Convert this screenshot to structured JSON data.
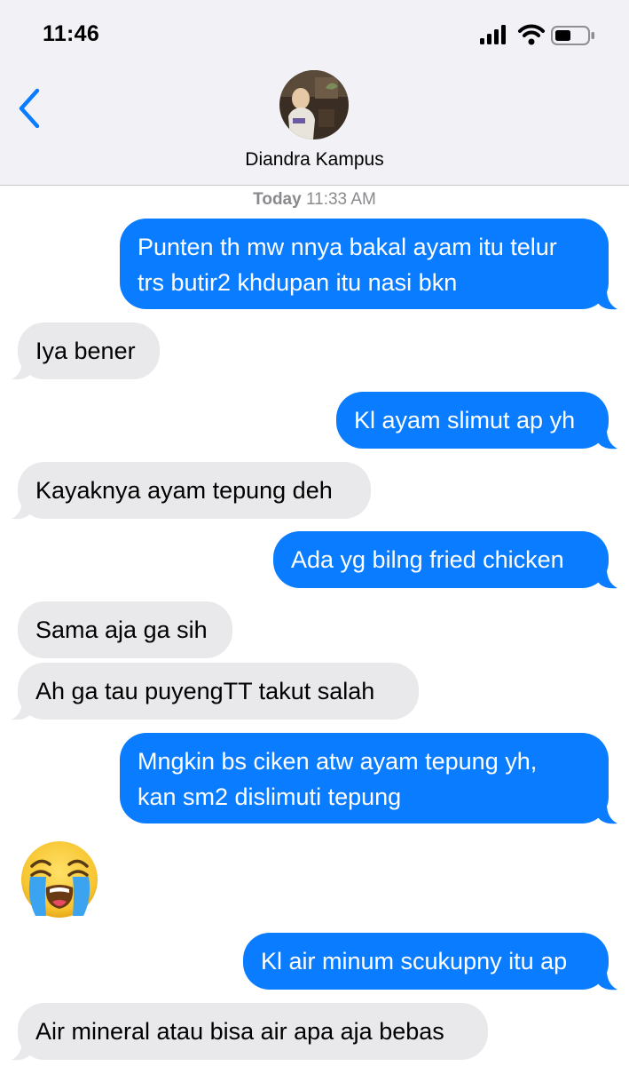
{
  "status_bar": {
    "time": "11:46"
  },
  "header": {
    "contact_name": "Diandra Kampus"
  },
  "thread": {
    "timestamp_day": "Today",
    "timestamp_time": "11:33 AM",
    "messages": [
      {
        "from": "me",
        "lines": [
          "Punten th mw nnya bakal ayam itu telur",
          "trs butir2 khdupan itu nasi bkn"
        ]
      },
      {
        "from": "them",
        "lines": [
          "Iya bener"
        ]
      },
      {
        "from": "me",
        "lines": [
          "Kl ayam slimut ap yh"
        ]
      },
      {
        "from": "them",
        "lines": [
          "Kayaknya ayam tepung deh"
        ]
      },
      {
        "from": "me",
        "lines": [
          "Ada yg bilng fried chicken"
        ]
      },
      {
        "from": "them",
        "lines": [
          "Sama aja ga sih"
        ]
      },
      {
        "from": "them",
        "lines": [
          "Ah ga tau puyengTT takut salah"
        ]
      },
      {
        "from": "me",
        "lines": [
          "Mngkin bs ciken atw ayam tepung yh,",
          "kan sm2 dislimuti tepung"
        ]
      },
      {
        "from": "them",
        "emoji": "loudly-crying-face"
      },
      {
        "from": "me",
        "lines": [
          "Kl air minum scukupny itu ap"
        ]
      },
      {
        "from": "them",
        "lines": [
          "Air mineral atau bisa air apa aja bebas"
        ]
      }
    ]
  },
  "colors": {
    "sent_bubble": "#0a7cff",
    "received_bubble": "#e9e9eb",
    "header_bg": "#f2f2f6",
    "back_arrow": "#0a7cff"
  }
}
